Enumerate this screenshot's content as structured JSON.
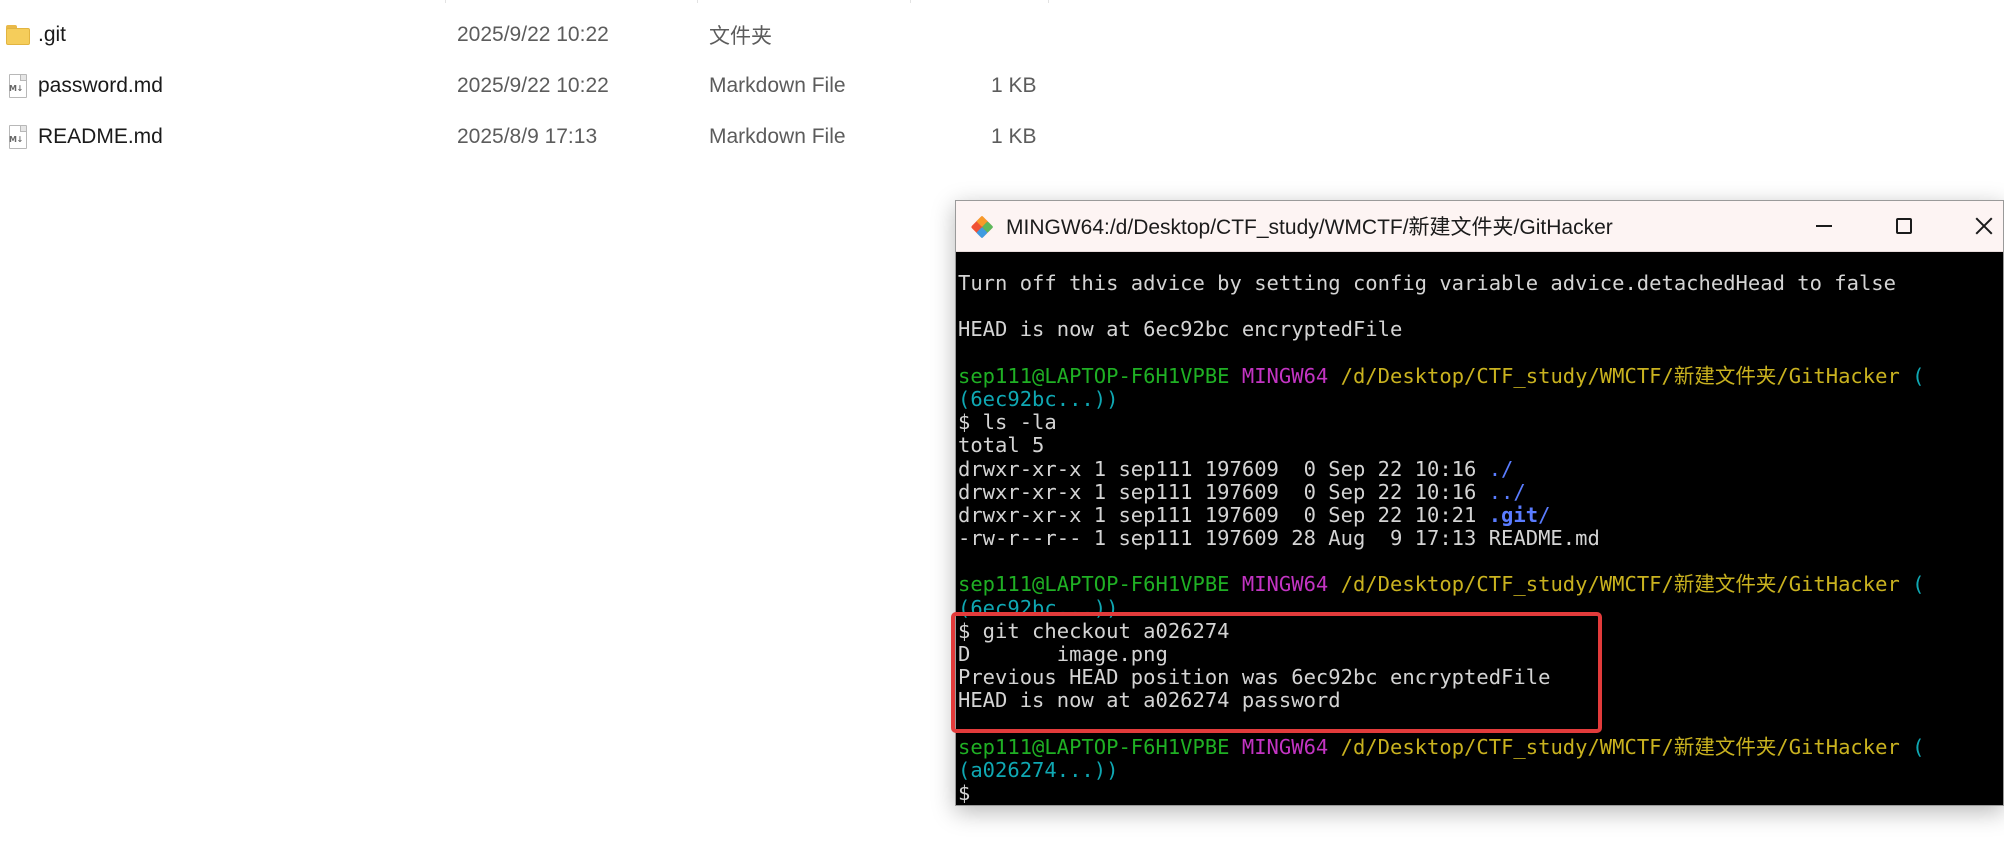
{
  "file_list": {
    "rows": [
      {
        "name": ".git",
        "date": "2025/9/22 10:22",
        "type": "文件夹",
        "size": "",
        "icon": "folder-icon"
      },
      {
        "name": "password.md",
        "date": "2025/9/22 10:22",
        "type": "Markdown File",
        "size": "1 KB",
        "icon": "markdown-file-icon"
      },
      {
        "name": "README.md",
        "date": "2025/8/9 17:13",
        "type": "Markdown File",
        "size": "1 KB",
        "icon": "markdown-file-icon"
      }
    ],
    "md_icon_tag": "M↓"
  },
  "terminal": {
    "title": "MINGW64:/d/Desktop/CTF_study/WMCTF/新建文件夹/GitHacker",
    "lines": {
      "l1": "Turn off this advice by setting config variable advice.detachedHead to false",
      "l2": "HEAD is now at 6ec92bc encryptedFile",
      "p1_user": "sep111@LAPTOP-F6H1VPBE",
      "p1_sys": "MINGW64",
      "p1_path": "/d/Desktop/CTF_study/WMCTF/新建文件夹/GitHacker",
      "p1_branch_open": " (",
      "p1_branch": "(6ec92bc...))",
      "cmd1": "$ ls -la",
      "ls_total": "total 5",
      "ls1_pre": "drwxr-xr-x 1 sep111 197609  0 Sep 22 10:16 ",
      "ls1_name": "./",
      "ls2_pre": "drwxr-xr-x 1 sep111 197609  0 Sep 22 10:16 ",
      "ls2_name": "../",
      "ls3_pre": "drwxr-xr-x 1 sep111 197609  0 Sep 22 10:21 ",
      "ls3_name": ".git",
      "ls3_slash": "/",
      "ls4": "-rw-r--r-- 1 sep111 197609 28 Aug  9 17:13 README.md",
      "p2_user": "sep111@LAPTOP-F6H1VPBE",
      "p2_sys": "MINGW64",
      "p2_path": "/d/Desktop/CTF_study/WMCTF/新建文件夹/GitHacker",
      "p2_branch_open": " (",
      "p2_branch": "(6ec92bc...))",
      "cmd2": "$ git checkout a026274",
      "out1": "D       image.png",
      "out2": "Previous HEAD position was 6ec92bc encryptedFile",
      "out3": "HEAD is now at a026274 password",
      "p3_user": "sep111@LAPTOP-F6H1VPBE",
      "p3_sys": "MINGW64",
      "p3_path": "/d/Desktop/CTF_study/WMCTF/新建文件夹/GitHacker",
      "p3_branch_open": " (",
      "p3_branch": "(a026274...))",
      "prompt": "$"
    }
  },
  "colors": {
    "prompt_user": "#1fb024",
    "prompt_system": "#c334c3",
    "prompt_path": "#c9b21f",
    "prompt_branch": "#0fa8b3",
    "directory": "#5a7cff",
    "highlight_box": "#e23b3b"
  }
}
